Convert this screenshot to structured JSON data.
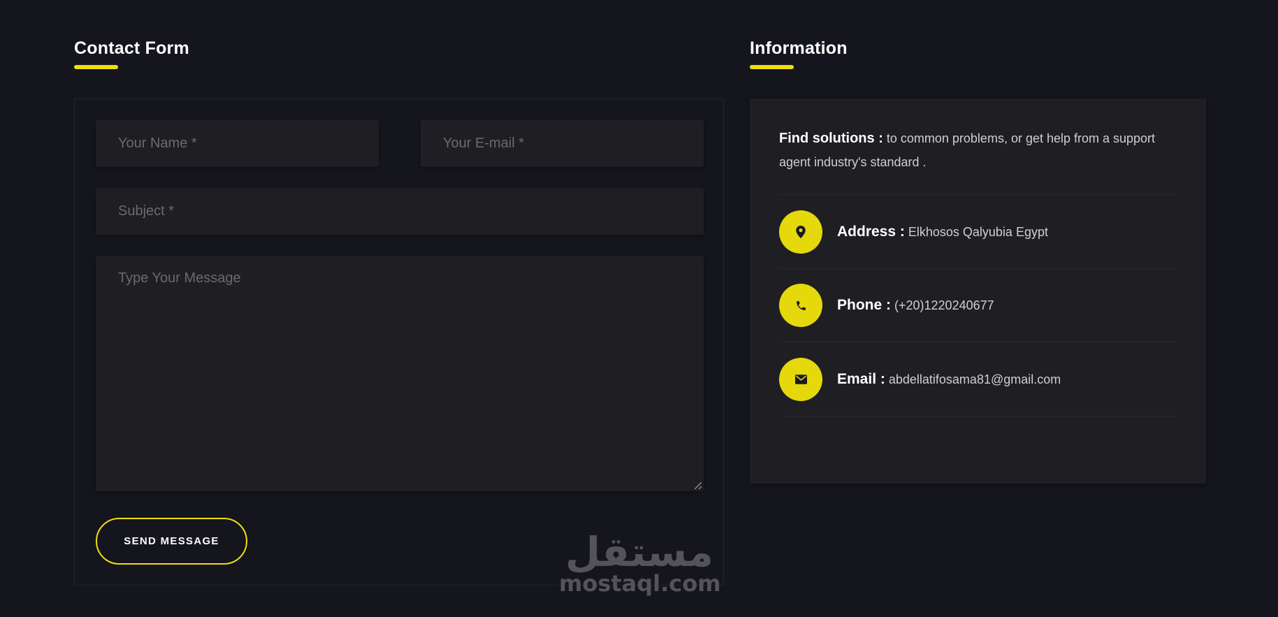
{
  "contact": {
    "title": "Contact Form",
    "name_placeholder": "Your Name *",
    "email_placeholder": "Your E-mail *",
    "subject_placeholder": "Subject *",
    "message_placeholder": "Type Your Message",
    "send_label": "SEND MESSAGE"
  },
  "info": {
    "title": "Information",
    "intro_label": "Find solutions :",
    "intro_text": " to common problems, or get help from a support agent industry's standard .",
    "address_label": "Address :",
    "address_value": " Elkhosos Qalyubia Egypt",
    "phone_label": "Phone :",
    "phone_value": " (+20)1220240677",
    "email_label": "Email :",
    "email_value": " abdellatifosama81@gmail.com"
  },
  "watermark": {
    "arabic": "مستقل",
    "latin": "mostaql.com"
  },
  "colors": {
    "accent": "#f0dd0e",
    "background": "#15151d",
    "panel": "#1f1e23"
  },
  "icons": {
    "address": "map-pin-icon",
    "phone": "phone-icon",
    "email": "envelope-icon"
  }
}
